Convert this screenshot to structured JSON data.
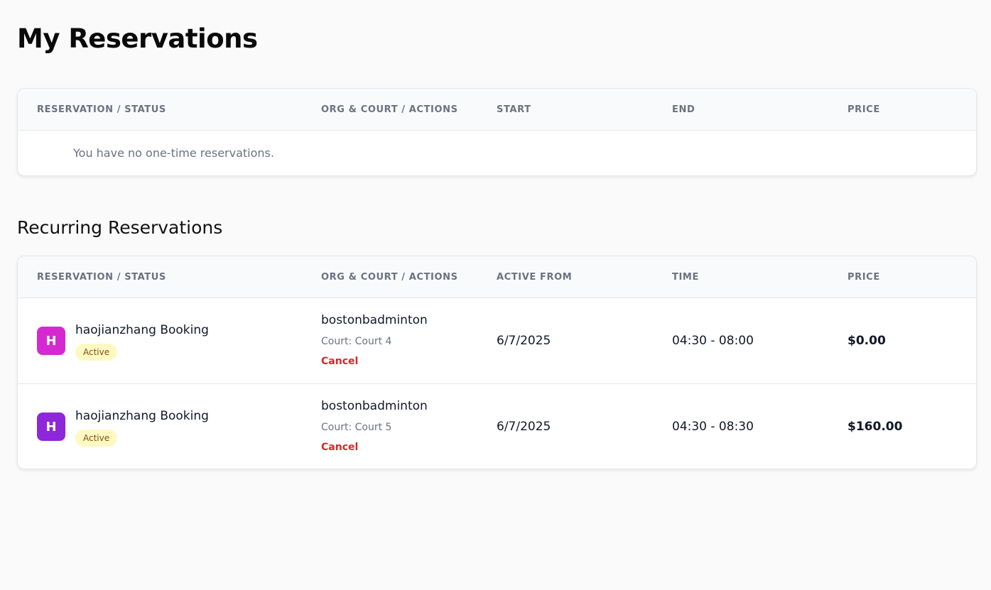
{
  "page": {
    "title": "My Reservations"
  },
  "one_time": {
    "headers": [
      "Reservation / Status",
      "Org & Court / Actions",
      "Start",
      "End",
      "Price"
    ],
    "empty_message": "You have no one-time reservations."
  },
  "recurring": {
    "title": "Recurring Reservations",
    "headers": [
      "Reservation / Status",
      "Org & Court / Actions",
      "Active From",
      "Time",
      "Price"
    ],
    "rows": [
      {
        "avatar_letter": "H",
        "avatar_color": "#d628d0",
        "name": "haojianzhang Booking",
        "status": "Active",
        "org": "bostonbadminton",
        "court": "Court: Court 4",
        "action": "Cancel",
        "active_from": "6/7/2025",
        "time": "04:30 - 08:00",
        "price": "$0.00"
      },
      {
        "avatar_letter": "H",
        "avatar_color": "#8e26d9",
        "name": "haojianzhang Booking",
        "status": "Active",
        "org": "bostonbadminton",
        "court": "Court: Court 5",
        "action": "Cancel",
        "active_from": "6/7/2025",
        "time": "04:30 - 08:30",
        "price": "$160.00"
      }
    ]
  },
  "colors": {
    "status_active_bg": "#fef9c3",
    "status_active_text": "#854d0e",
    "cancel": "#dc2626"
  }
}
